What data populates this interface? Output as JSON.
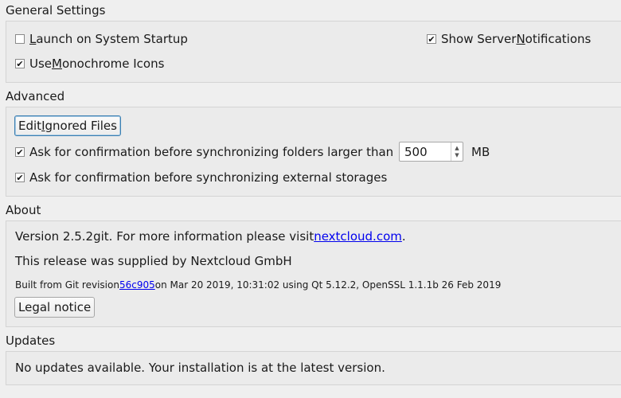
{
  "general": {
    "title": "General Settings",
    "launch": {
      "pre": "",
      "mn": "L",
      "post": "aunch on System Startup",
      "checked": false
    },
    "server_notif": {
      "pre": "Show Server ",
      "mn": "N",
      "post": "otifications",
      "checked": true
    },
    "mono": {
      "pre": "Use ",
      "mn": "M",
      "post": "onochrome Icons",
      "checked": true
    }
  },
  "advanced": {
    "title": "Advanced",
    "edit_ignored": {
      "pre": "Edit ",
      "mn": "I",
      "post": "gnored Files"
    },
    "confirm_large": {
      "label": "Ask for confirmation before synchronizing folders larger than",
      "checked": true
    },
    "size_value": "500",
    "size_unit": "MB",
    "confirm_external": {
      "label": "Ask for confirmation before synchronizing external storages",
      "checked": true
    }
  },
  "about": {
    "title": "About",
    "version_pre": "Version 2.5.2git. For more information please visit ",
    "version_link": "nextcloud.com",
    "version_post": ".",
    "supplied": "This release was supplied by Nextcloud GmbH",
    "built_pre": "Built from Git revision ",
    "built_link": "56c905",
    "built_post": " on Mar 20 2019, 10:31:02 using Qt 5.12.2, OpenSSL 1.1.1b 26 Feb 2019",
    "legal_button": "Legal notice"
  },
  "updates": {
    "title": "Updates",
    "status": "No updates available. Your installation is at the latest version."
  },
  "icons": {
    "check": "checkmark-icon",
    "spin_up": "spin-up-icon",
    "spin_down": "spin-down-icon"
  }
}
